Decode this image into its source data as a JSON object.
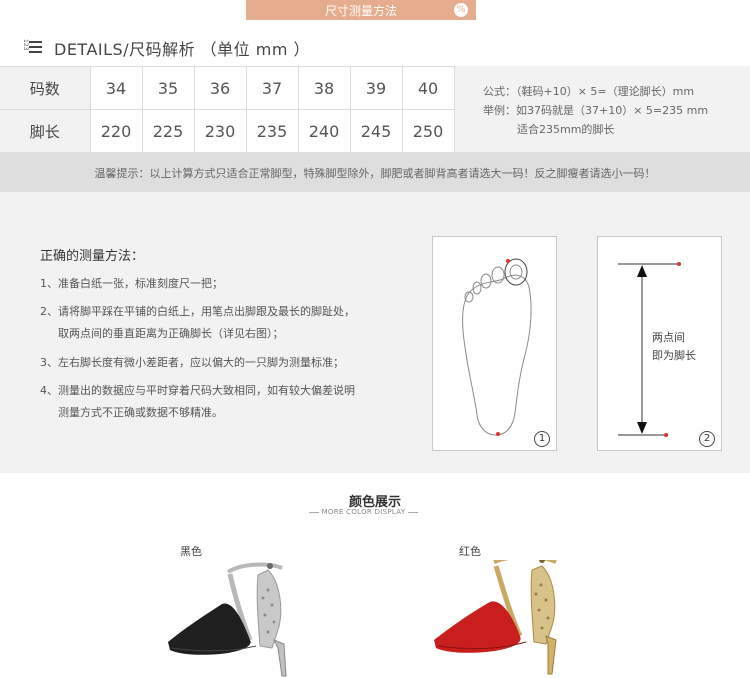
{
  "banner": {
    "title": "尺寸测量方法",
    "percent_icon": "%"
  },
  "details": {
    "icon_numbers": "123",
    "label": "DETAILS/尺码解析 （单位 mm ）"
  },
  "table": {
    "row1_label": "码数",
    "row2_label": "脚长",
    "sizes": [
      "34",
      "35",
      "36",
      "37",
      "38",
      "39",
      "40"
    ],
    "lengths": [
      "220",
      "225",
      "230",
      "235",
      "240",
      "245",
      "250"
    ]
  },
  "formula": {
    "line1": "公式：（鞋码+10）× 5=（理论脚长）mm",
    "line2": "举例：如37码就是（37+10）× 5=235 mm",
    "line3": "适合235mm的脚长"
  },
  "tip": "温馨提示：以上计算方式只适合正常脚型，特殊脚型除外，脚肥或者脚背高者请选大一码！反之脚瘦者请选小一码！",
  "measure": {
    "title": "正确的测量方法：",
    "step1": "1、准备白纸一张，标准刻度尺一把；",
    "step2a": "2、请将脚平踩在平铺的白纸上，用笔点出脚跟及最长的脚趾处，",
    "step2b": "取两点间的垂直距离为正确脚长（详见右图）；",
    "step3": "3、左右脚长度有微小差距者，应以偏大的一只脚为测量标准；",
    "step4a": "4、测量出的数据应与平时穿着尺码大致相同，如有较大偏差说明",
    "step4b": "测量方式不正确或数据不够精准。",
    "fig1_num": "1",
    "fig2_num": "2",
    "fig2_text1": "两点间",
    "fig2_text2": "即为脚长"
  },
  "colors": {
    "title": "颜色展示",
    "subtitle": "MORE COLOR DISPLAY",
    "black_label": "黑色",
    "red_label": "红色"
  },
  "palette": {
    "banner": "#e5ac8d",
    "grey_bg": "#f2f2f2",
    "tip_bg": "#dedede",
    "dot_red": "#d9352b",
    "shoe_black": "#1f1f1f",
    "shoe_red": "#c81e1e",
    "silver": "#b8b8b8",
    "gold": "#c9a861"
  }
}
